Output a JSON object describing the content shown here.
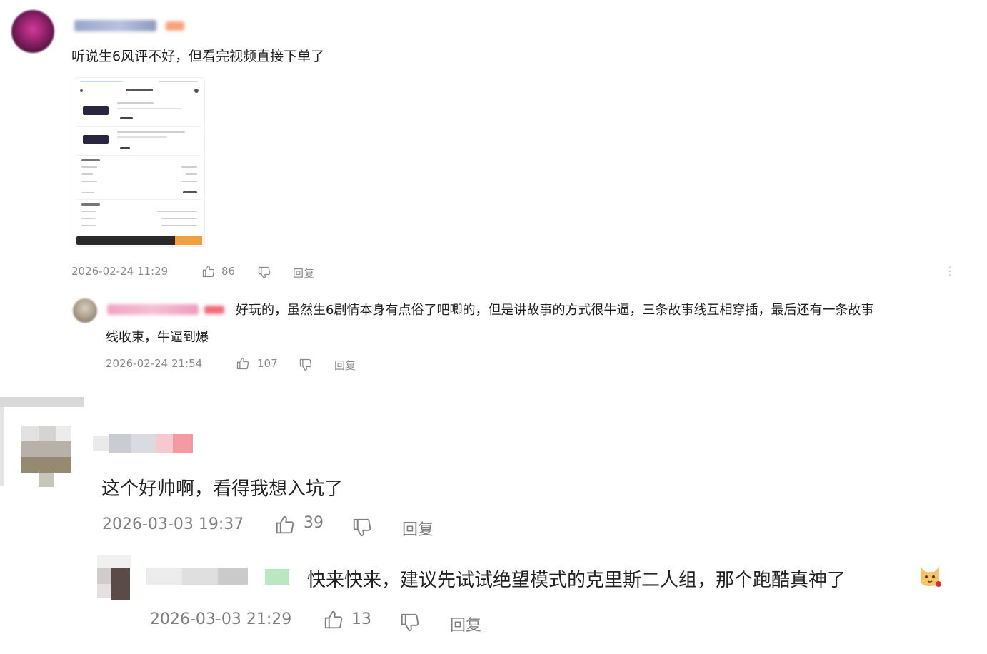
{
  "comments": [
    {
      "text": "听说生6风评不好，但看完视频直接下单了",
      "time": "2026-02-24 11:29",
      "likes": "86",
      "reply_label": "回复",
      "more_label": "⋮",
      "reply": {
        "text_line1": "好玩的，虽然生6剧情本身有点俗了吧唧的，但是讲故事的方式很牛逼，三条故事线互相穿插，最后还有一条故事",
        "text_line2": "线收束，牛逼到爆",
        "time": "2026-02-24 21:54",
        "likes": "107",
        "reply_label": "回复"
      }
    },
    {
      "text": "这个好帅啊，看得我想入坑了",
      "time": "2026-03-03 19:37",
      "likes": "39",
      "reply_label": "回复",
      "reply": {
        "text": "快来快来，建议先试试绝望模式的克里斯二人组，那个跑酷真神了",
        "time": "2026-03-03 21:29",
        "likes": "13",
        "reply_label": "回复"
      }
    }
  ],
  "colors": {
    "meta": "#8a8a8a",
    "text": "#1f1f1f",
    "username_pink": "#f3a6b8",
    "avatar_purple": "#7a1f5e"
  }
}
